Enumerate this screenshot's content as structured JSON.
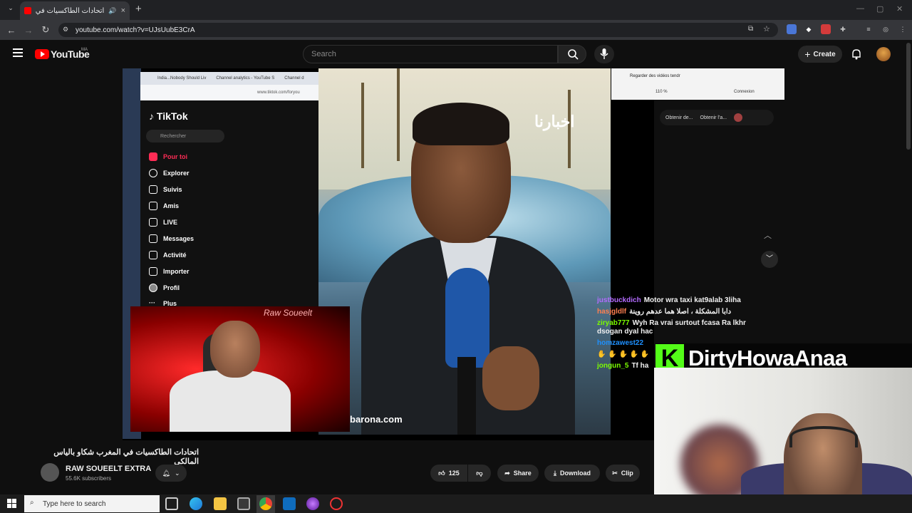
{
  "browser": {
    "tab_title": "اتحادات الطاكسيات في المغرب",
    "url": "youtube.com/watch?v=UJsUubE3CrA"
  },
  "header": {
    "logo_text": "YouTube",
    "country": "MA",
    "search_placeholder": "Search",
    "create_label": "Create"
  },
  "video_content": {
    "tiktok": {
      "tab_labels": [
        "India...Nobody Should Liv",
        "Channel analytics - YouTube S",
        "Channel d"
      ],
      "url": "www.tiktok.com/foryou",
      "logo": "TikTok",
      "search_placeholder": "Rechercher",
      "nav": [
        {
          "label": "Pour toi",
          "icon": "home-icon"
        },
        {
          "label": "Explorer",
          "icon": "compass-icon"
        },
        {
          "label": "Suivis",
          "icon": "following-icon"
        },
        {
          "label": "Amis",
          "icon": "friends-icon"
        },
        {
          "label": "LIVE",
          "icon": "live-icon"
        },
        {
          "label": "Messages",
          "icon": "messages-icon"
        },
        {
          "label": "Activité",
          "icon": "activity-icon"
        },
        {
          "label": "Importer",
          "icon": "upload-icon"
        },
        {
          "label": "Profil",
          "icon": "profile-icon"
        },
        {
          "label": "Plus",
          "icon": "more-icon"
        }
      ]
    },
    "news_logo": "اخبارنا",
    "watermark": "barona.com",
    "right_panel": {
      "tab": "Regarder des vidéos tendr",
      "zoom": "110 %",
      "login": "Connexion",
      "button1": "Obtenir de...",
      "button2": "Obtenir l'a..."
    },
    "chat": [
      {
        "user": "justbuckdich",
        "color": "#b36bff",
        "msg": "Motor wra taxi kat9alab 3liha"
      },
      {
        "user": "hasjgldlf",
        "color": "#ff7f50",
        "msg": "دابا المشكلة ، اصلا هما عدهم روينة"
      },
      {
        "user": "ziryab777",
        "color": "#7cfc00",
        "msg": "Wyh Ra vrai surtout fcasa Ra lkhr dsogan dyal hac"
      },
      {
        "user": "homzawest22",
        "color": "#1e90ff",
        "msg": ""
      },
      {
        "user": "",
        "color": "#ffffff",
        "msg": "✋ ✋ ✋ ✋ ✋"
      },
      {
        "user": "jongun_5",
        "color": "#7cfc00",
        "msg": "Tf ha"
      }
    ],
    "streamer_banner": "DirtyHowaAnaa",
    "kick_letter": "K",
    "webcam_overlay_text": "Raw Soueelt"
  },
  "video_info": {
    "title": "اتحادات الطاكسيات في المغرب شكاو بالياس المالكي",
    "channel_name": "RAW SOUEELT EXTRA",
    "subscribers": "55.6K subscribers",
    "like_count": "125",
    "share_label": "Share",
    "download_label": "Download",
    "clip_label": "Clip"
  },
  "taskbar": {
    "search_placeholder": "Type here to search"
  }
}
